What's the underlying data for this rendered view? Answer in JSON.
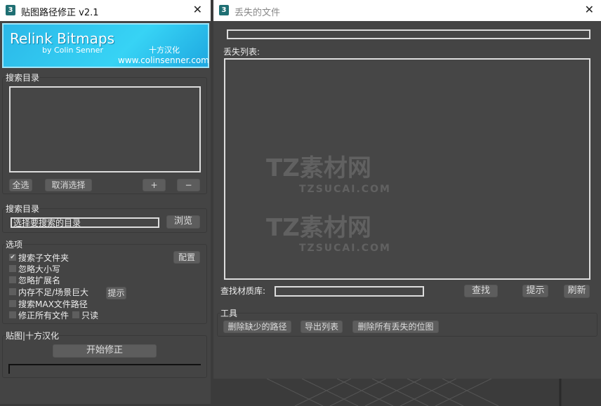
{
  "left_window": {
    "title": "贴图路径修正 v2.1",
    "banner": {
      "title": "Relink Bitmaps",
      "author": "by Colin Senner",
      "translator": "十方汉化",
      "url": "www.colinsenner.com"
    },
    "search_dirs": {
      "label": "搜索目录",
      "select_all": "全选",
      "deselect": "取消选择",
      "add": "+",
      "remove": "−"
    },
    "search_dir": {
      "label": "搜索目录",
      "input_value": "选择要搜索的目录",
      "browse": "浏览"
    },
    "options": {
      "label": "选项",
      "config": "配置",
      "hint": "提示",
      "items": [
        {
          "label": "搜索子文件夹",
          "checked": true
        },
        {
          "label": "忽略大小写",
          "checked": false
        },
        {
          "label": "忽略扩展名",
          "checked": false
        },
        {
          "label": "内存不足/场景巨大",
          "checked": false
        },
        {
          "label": "搜索MAX文件路径",
          "checked": false
        },
        {
          "label": "修正所有文件",
          "checked": false
        }
      ],
      "readonly": {
        "label": "只读",
        "checked": false
      }
    },
    "run": {
      "label": "贴图|十方汉化",
      "start": "开始修正",
      "progress": 0
    }
  },
  "right_window": {
    "title": "丢失的文件",
    "list_label": "丢失列表:",
    "material_lib_label": "查找材质库:",
    "material_lib_value": "",
    "find": "查找",
    "hint": "提示",
    "refresh": "刷新",
    "tools": {
      "label": "工具",
      "delete_missing": "删除缺少的路径",
      "export_list": "导出列表",
      "delete_all_missing": "删除所有丢失的位图"
    }
  },
  "watermark": {
    "brand": "TZ素材网",
    "url": "TZSUCAI.COM"
  }
}
